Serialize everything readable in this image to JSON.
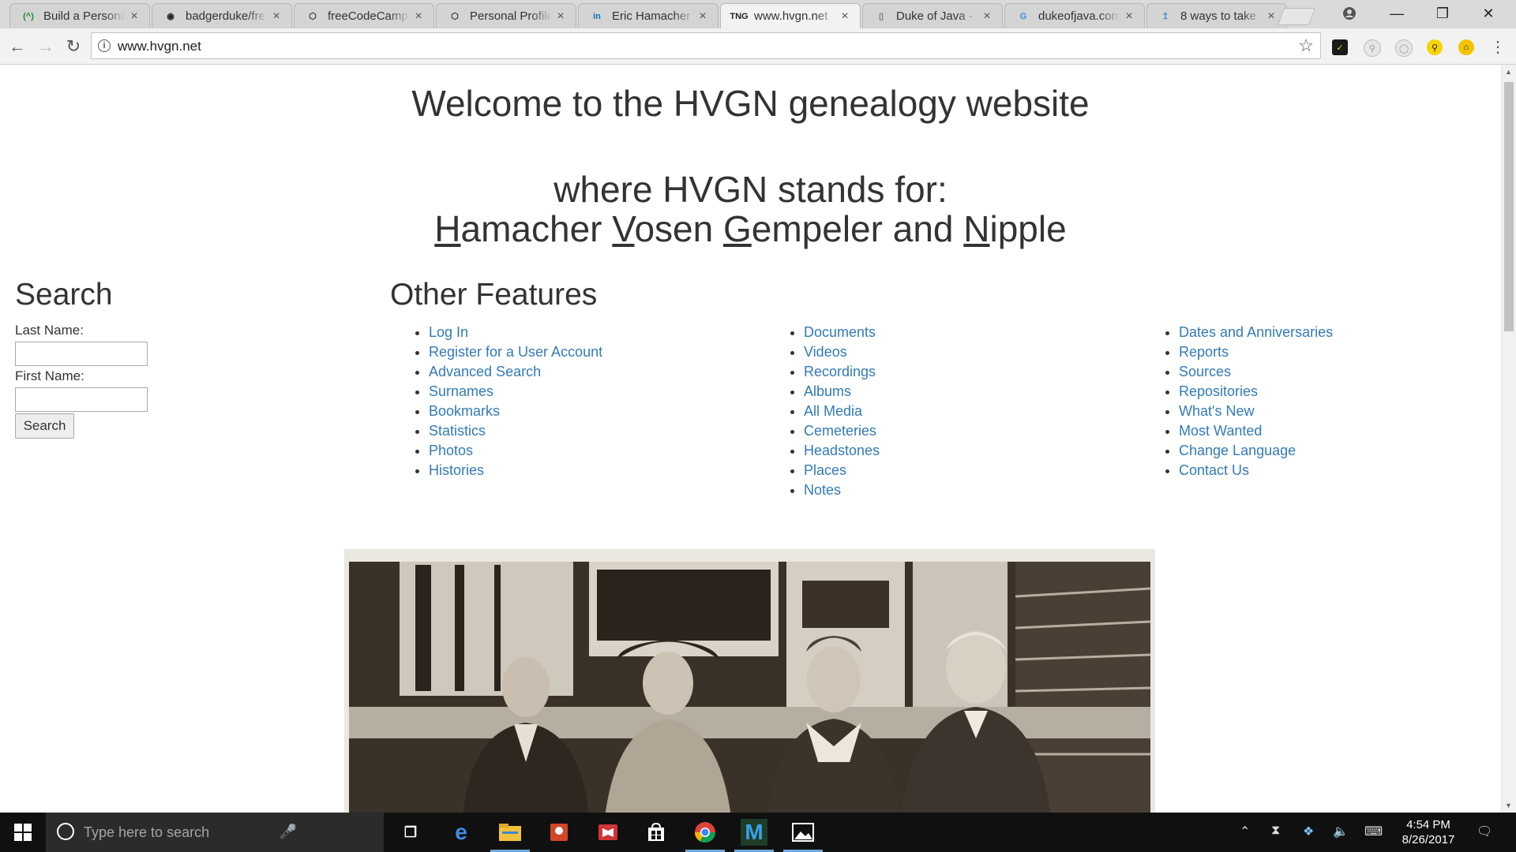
{
  "browser": {
    "tabs": [
      {
        "title": "Build a Persona",
        "favicon": "fcc-project-icon",
        "fav_color": "#1e8a2e",
        "fav_glyph": "(^)"
      },
      {
        "title": "badgerduke/fre",
        "favicon": "github-icon",
        "fav_color": "#222222",
        "fav_glyph": "◉"
      },
      {
        "title": "freeCodeCamp",
        "favicon": "codepen-icon",
        "fav_color": "#333333",
        "fav_glyph": "⬡"
      },
      {
        "title": "Personal Profile",
        "favicon": "codepen-icon",
        "fav_color": "#333333",
        "fav_glyph": "⬡"
      },
      {
        "title": "Eric Hamacher",
        "favicon": "linkedin-icon",
        "fav_color": "#0077b5",
        "fav_glyph": "in"
      },
      {
        "title": "www.hvgn.net",
        "favicon": "tng-icon",
        "fav_color": "#222222",
        "fav_glyph": "TNG",
        "active": true
      },
      {
        "title": "Duke of Java -",
        "favicon": "page-icon",
        "fav_color": "#777777",
        "fav_glyph": "▯"
      },
      {
        "title": "dukeofjava.com",
        "favicon": "google-icon",
        "fav_color": "#4285f4",
        "fav_glyph": "G"
      },
      {
        "title": "8 ways to take",
        "favicon": "download-icon",
        "fav_color": "#4a90d9",
        "fav_glyph": "↥"
      }
    ],
    "url": "www.hvgn.net"
  },
  "page": {
    "welcome": "Welcome to the HVGN genealogy website",
    "stands_for": "where HVGN stands for:",
    "names": [
      {
        "initial": "H",
        "rest": "amacher"
      },
      {
        "initial": "V",
        "rest": "osen"
      },
      {
        "initial": "G",
        "rest": "empeler"
      },
      {
        "initial": "N",
        "rest": "ipple"
      }
    ],
    "and": "and",
    "search": {
      "heading": "Search",
      "last_name_label": "Last Name:",
      "first_name_label": "First Name:",
      "button": "Search"
    },
    "features": {
      "heading": "Other Features",
      "columns": [
        [
          "Log In",
          "Register for a User Account",
          "Advanced Search",
          "Surnames",
          "Bookmarks",
          "Statistics",
          "Photos",
          "Histories"
        ],
        [
          "Documents",
          "Videos",
          "Recordings",
          "Albums",
          "All Media",
          "Cemeteries",
          "Headstones",
          "Places",
          "Notes"
        ],
        [
          "Dates and Anniversaries",
          "Reports",
          "Sources",
          "Repositories",
          "What's New",
          "Most Wanted",
          "Change Language",
          "Contact Us"
        ]
      ]
    },
    "link_color": "#337ab7"
  },
  "taskbar": {
    "search_placeholder": "Type here to search",
    "time": "4:54 PM",
    "date": "8/26/2017"
  }
}
